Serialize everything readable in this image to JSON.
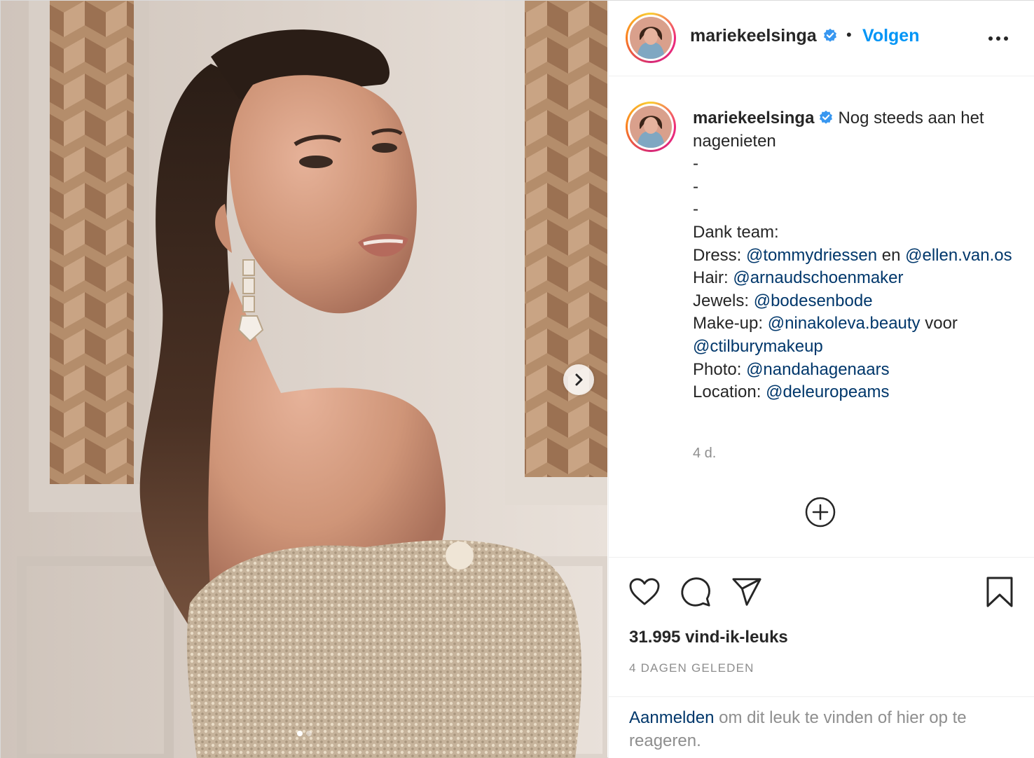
{
  "header": {
    "username": "mariekeelsinga",
    "separator": "•",
    "follow_label": "Volgen",
    "more_icon": "more-horizontal-icon"
  },
  "caption": {
    "username": "mariekeelsinga",
    "text_intro": "Nog steeds aan het nagenieten",
    "dash1": "-",
    "dash2": "-",
    "dash3": "-",
    "team_label": "Dank team:",
    "dress_label": "Dress:",
    "dress_tag1": "@tommydriessen",
    "dress_and": "en",
    "dress_tag2": "@ellen.van.os",
    "hair_label": "Hair:",
    "hair_tag": "@arnaudschoenmaker",
    "jewels_label": "Jewels:",
    "jewels_tag": "@bodesenbode",
    "makeup_label": "Make-up:",
    "makeup_tag1": "@ninakoleva.beauty",
    "makeup_for": "voor",
    "makeup_tag2": "@ctilburymakeup",
    "photo_label": "Photo:",
    "photo_tag": "@nandahagenaars",
    "location_label": "Location:",
    "location_tag": "@deleuropeams",
    "time_ago": "4 d."
  },
  "actions": {
    "like_icon": "heart-icon",
    "comment_icon": "comment-icon",
    "share_icon": "paper-plane-icon",
    "save_icon": "bookmark-icon",
    "likes_text": "31.995 vind-ik-leuks",
    "date_text": "4 DAGEN GELEDEN"
  },
  "login": {
    "link_label": "Aanmelden",
    "rest_text": "om dit leuk te vinden of hier op te reageren."
  },
  "media": {
    "slide_count": 2,
    "active_slide": 1,
    "next_icon": "chevron-right-icon"
  },
  "colors": {
    "link_blue": "#0095f6",
    "tag_blue": "#00376b",
    "muted": "#8e8e8e",
    "verified": "#3897f0"
  }
}
